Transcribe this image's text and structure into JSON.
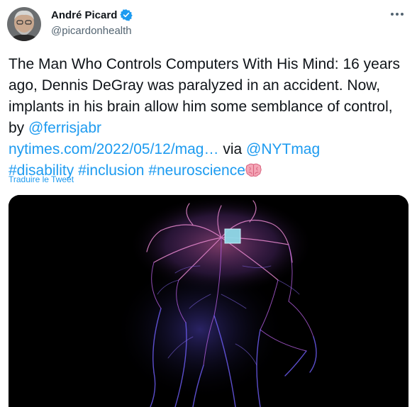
{
  "author": {
    "display_name": "André Picard",
    "handle": "@picardonhealth"
  },
  "tweet": {
    "text_1": "The Man Who Controls Computers With His Mind: 16 years ago, Dennis DeGray was paralyzed in an accident. Now, implants in his brain allow him some semblance of control, by ",
    "mention_1": "@ferrisjabr",
    "link_url": "nytimes.com/2022/05/12/mag…",
    "text_2": " via ",
    "mention_2": "@NYTmag",
    "hashtags": [
      "#disability",
      "#inclusion",
      "#neuroscience"
    ]
  },
  "translate_label": "Traduire le Tweet",
  "icons": {
    "verified": "verified-badge-icon",
    "more": "more-options-icon",
    "brain": "brain-emoji-icon"
  },
  "colors": {
    "link": "#1d9bf0",
    "text": "#0f1419",
    "secondary": "#536471"
  }
}
